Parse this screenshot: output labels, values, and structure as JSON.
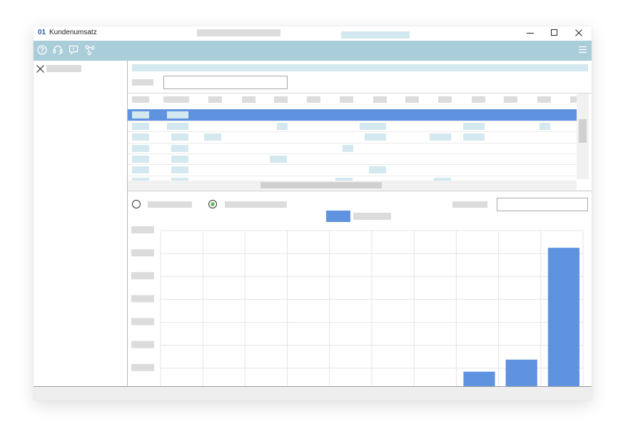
{
  "window": {
    "app_number": "01",
    "title": "Kundenumsatz",
    "controls": {
      "minimize": "minimize-icon",
      "maximize": "maximize-icon",
      "close": "close-icon"
    }
  },
  "toolbar": {
    "icons": [
      "help-icon",
      "support-headset-icon",
      "feedback-icon",
      "share-icon"
    ],
    "menu_icon": "hamburger-menu-icon"
  },
  "colors": {
    "toolbar": "#a9cdd9",
    "selection": "#5f93e0",
    "bar": "#5f93e0",
    "placeholder_blue": "#d4e8ef"
  },
  "sidebar": {
    "close_icon": "close-icon"
  },
  "filter": {
    "search_value": ""
  },
  "chart_panel": {
    "right_input_value": "",
    "radio_option_1_selected": false,
    "radio_option_2_selected": true
  },
  "chart_data": {
    "type": "bar",
    "categories": [
      "",
      "",
      "",
      "",
      "",
      "",
      "",
      "",
      "",
      ""
    ],
    "values": [
      0,
      0,
      0,
      0,
      0,
      0,
      0.4,
      3.4,
      5.5,
      25.0
    ],
    "ylim": [
      0,
      28
    ],
    "grid": true,
    "legend": "top-center",
    "series_color": "#5f93e0"
  }
}
